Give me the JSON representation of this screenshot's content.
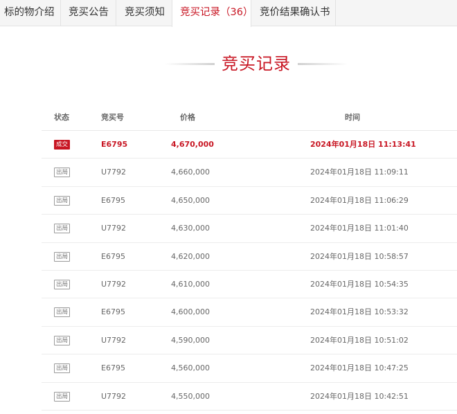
{
  "tabs": [
    {
      "label": "标的物介绍",
      "active": false
    },
    {
      "label": "竞买公告",
      "active": false
    },
    {
      "label": "竞买须知",
      "active": false
    },
    {
      "label": "竞买记录（36）",
      "active": true
    },
    {
      "label": "竞价结果确认书",
      "active": false
    }
  ],
  "section": {
    "title": "竞买记录"
  },
  "table": {
    "headers": {
      "status": "状态",
      "bid_no": "竞买号",
      "price": "价格",
      "time": "时间"
    },
    "rows": [
      {
        "status": "成交",
        "bid_no": "E6795",
        "price": "4,670,000",
        "time": "2024年01月18日 11:13:41"
      },
      {
        "status": "出局",
        "bid_no": "U7792",
        "price": "4,660,000",
        "time": "2024年01月18日 11:09:11"
      },
      {
        "status": "出局",
        "bid_no": "E6795",
        "price": "4,650,000",
        "time": "2024年01月18日 11:06:29"
      },
      {
        "status": "出局",
        "bid_no": "U7792",
        "price": "4,630,000",
        "time": "2024年01月18日 11:01:40"
      },
      {
        "status": "出局",
        "bid_no": "E6795",
        "price": "4,620,000",
        "time": "2024年01月18日 10:58:57"
      },
      {
        "status": "出局",
        "bid_no": "U7792",
        "price": "4,610,000",
        "time": "2024年01月18日 10:54:35"
      },
      {
        "status": "出局",
        "bid_no": "E6795",
        "price": "4,600,000",
        "time": "2024年01月18日 10:53:32"
      },
      {
        "status": "出局",
        "bid_no": "U7792",
        "price": "4,590,000",
        "time": "2024年01月18日 10:51:02"
      },
      {
        "status": "出局",
        "bid_no": "E6795",
        "price": "4,560,000",
        "time": "2024年01月18日 10:47:25"
      },
      {
        "status": "出局",
        "bid_no": "U7792",
        "price": "4,550,000",
        "time": "2024年01月18日 10:42:51"
      }
    ]
  },
  "colors": {
    "accent": "#c81623",
    "tab_bg": "#f5f5f5"
  }
}
